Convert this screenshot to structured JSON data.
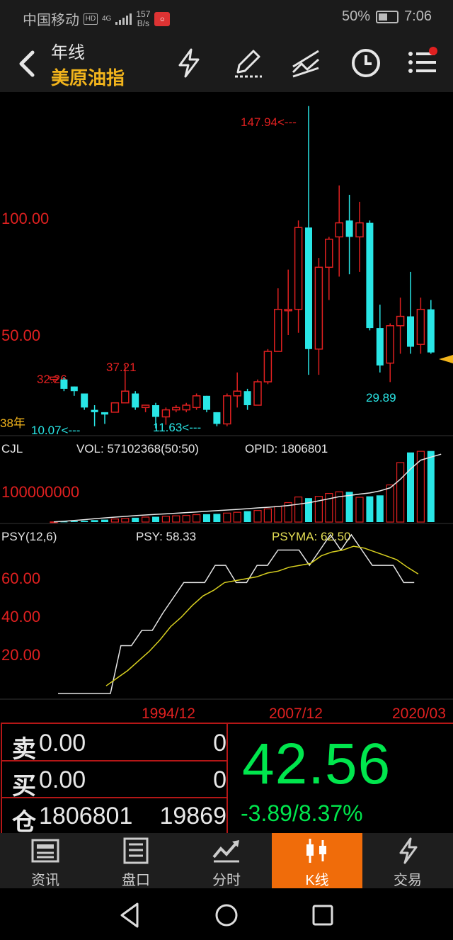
{
  "status_bar": {
    "carrier": "中国移动",
    "hd": "HD",
    "net": "4G",
    "speed_value": "157",
    "speed_unit": "B/s",
    "battery": "50%",
    "time": "7:06"
  },
  "header": {
    "period": "年线",
    "instrument": "美原油指"
  },
  "chart": {
    "y_labels": [
      "100.00",
      "50.00"
    ],
    "max_label": "147.94<---",
    "low_labels": {
      "first": "32.26",
      "mid": "37.21",
      "low1": "10.07<---",
      "low2": "11.63<---",
      "last_low": "29.89"
    },
    "left_tag": "38年",
    "vol_title": "CJL",
    "vol_text": "VOL: 57102368(50:50)",
    "opid_text": "OPID: 1806801",
    "vol_axis": "100000000",
    "psy_title": "PSY(12,6)",
    "psy_text": "PSY: 58.33",
    "psyma_text": "PSYMA: 62.50",
    "psy_axis": [
      "60.00",
      "40.00",
      "20.00"
    ],
    "x_labels": [
      "1994/12",
      "2007/12",
      "2020/03"
    ]
  },
  "chart_data": {
    "type": "candlestick",
    "y_axis_labels": [
      100.0,
      50.0
    ],
    "highest": 147.94,
    "lowest": 10.07,
    "last_low": 29.89,
    "candles": [
      {
        "o": 31,
        "c": 32,
        "h": 32.3,
        "l": 30,
        "up": true
      },
      {
        "o": 31,
        "c": 27,
        "h": 32,
        "l": 26,
        "up": false
      },
      {
        "o": 28,
        "c": 26,
        "h": 28,
        "l": 24,
        "up": false
      },
      {
        "o": 25,
        "c": 19,
        "h": 25,
        "l": 18,
        "up": false
      },
      {
        "o": 18,
        "c": 17,
        "h": 20,
        "l": 11,
        "up": false
      },
      {
        "o": 16,
        "c": 17,
        "h": 17,
        "l": 12,
        "up": false
      },
      {
        "o": 17,
        "c": 21,
        "h": 21,
        "l": 17,
        "up": true
      },
      {
        "o": 21,
        "c": 26,
        "h": 37.21,
        "l": 21,
        "up": true
      },
      {
        "o": 25,
        "c": 19,
        "h": 26,
        "l": 18,
        "up": false
      },
      {
        "o": 19,
        "c": 20,
        "h": 20,
        "l": 17,
        "up": true
      },
      {
        "o": 20,
        "c": 15,
        "h": 21,
        "l": 10.07,
        "up": false
      },
      {
        "o": 15,
        "c": 18,
        "h": 19,
        "l": 11.63,
        "up": true
      },
      {
        "o": 18,
        "c": 19,
        "h": 20,
        "l": 17,
        "up": true
      },
      {
        "o": 18,
        "c": 20,
        "h": 21,
        "l": 17,
        "up": true
      },
      {
        "o": 19,
        "c": 24,
        "h": 25,
        "l": 18,
        "up": true
      },
      {
        "o": 24,
        "c": 18,
        "h": 24,
        "l": 17,
        "up": false
      },
      {
        "o": 17,
        "c": 12,
        "h": 17,
        "l": 11,
        "up": false
      },
      {
        "o": 12,
        "c": 24,
        "h": 25,
        "l": 11,
        "up": true
      },
      {
        "o": 24,
        "c": 26,
        "h": 34,
        "l": 19,
        "up": true
      },
      {
        "o": 26,
        "c": 20,
        "h": 27,
        "l": 18,
        "up": false
      },
      {
        "o": 20,
        "c": 30,
        "h": 31,
        "l": 20,
        "up": true
      },
      {
        "o": 30,
        "c": 43,
        "h": 44,
        "l": 29,
        "up": true
      },
      {
        "o": 43,
        "c": 61,
        "h": 70,
        "l": 43,
        "up": true
      },
      {
        "o": 61,
        "c": 61,
        "h": 78,
        "l": 50,
        "up": true
      },
      {
        "o": 61,
        "c": 96,
        "h": 99,
        "l": 51,
        "up": true
      },
      {
        "o": 96,
        "c": 44,
        "h": 147.94,
        "l": 33,
        "up": false
      },
      {
        "o": 44,
        "c": 79,
        "h": 83,
        "l": 33,
        "up": true
      },
      {
        "o": 79,
        "c": 91,
        "h": 92,
        "l": 65,
        "up": true
      },
      {
        "o": 92,
        "c": 98,
        "h": 114,
        "l": 75,
        "up": true
      },
      {
        "o": 99,
        "c": 92,
        "h": 110,
        "l": 76,
        "up": false
      },
      {
        "o": 92,
        "c": 98,
        "h": 107,
        "l": 77,
        "up": true
      },
      {
        "o": 98,
        "c": 53,
        "h": 99,
        "l": 52,
        "up": false
      },
      {
        "o": 53,
        "c": 37,
        "h": 63,
        "l": 34,
        "up": false
      },
      {
        "o": 38,
        "c": 54,
        "h": 55,
        "l": 29.89,
        "up": true
      },
      {
        "o": 54,
        "c": 58,
        "h": 66,
        "l": 42,
        "up": true
      },
      {
        "o": 58,
        "c": 45,
        "h": 77,
        "l": 42,
        "up": false
      },
      {
        "o": 46,
        "c": 61,
        "h": 66,
        "l": 42,
        "up": true
      },
      {
        "o": 61,
        "c": 42.56,
        "h": 65,
        "l": 42,
        "up": false
      }
    ],
    "volume": [
      0.1,
      0.3,
      0.6,
      0.8,
      1.2,
      1.5,
      1.9,
      2.3,
      2.7,
      3.1,
      3.3,
      3.6,
      3.9,
      4.1,
      4.6,
      4.9,
      5.1,
      5.6,
      6.1,
      6.8,
      7.2,
      8.2,
      9.7,
      12.1,
      15.6,
      14.9,
      16.0,
      17.8,
      18.8,
      18.8,
      15.4,
      16.0,
      16.6,
      23.1,
      37.0,
      43.3,
      44.0,
      44.2,
      12.8
    ],
    "volume_ma": [
      0.1,
      0.5,
      1.0,
      1.5,
      2.1,
      2.6,
      3.1,
      3.5,
      4.0,
      4.4,
      4.8,
      5.1,
      5.5,
      5.9,
      6.3,
      6.7,
      7.1,
      7.5,
      7.9,
      8.3,
      8.8,
      9.2,
      9.7,
      10.3,
      11.1,
      12.0,
      13.2,
      14.5,
      15.8,
      16.5,
      17.4,
      18.1,
      19.4,
      21.3,
      26.6,
      33.0,
      38.5,
      40.4,
      42.2
    ],
    "psy": [
      0,
      0,
      0,
      0,
      0,
      0,
      25,
      25,
      33,
      33,
      42,
      50,
      58,
      58,
      58,
      67,
      67,
      58,
      58,
      67,
      67,
      75,
      75,
      75,
      67,
      75,
      83,
      75,
      83,
      75,
      67,
      67,
      67,
      58,
      58
    ],
    "psyma": [
      0,
      0,
      0,
      0,
      0,
      0,
      4,
      8,
      12,
      17,
      22,
      28,
      35,
      40,
      46,
      51,
      54,
      58,
      59,
      60,
      61,
      63,
      64,
      66,
      67,
      68,
      72,
      74,
      75,
      77,
      76,
      74,
      72,
      70,
      66,
      62.5
    ]
  },
  "quote": {
    "sell_label": "卖",
    "sell_value": "0.00",
    "sell_vol": "0",
    "buy_label": "买",
    "buy_value": "0.00",
    "buy_vol": "0",
    "pos_label": "仓",
    "pos_value": "1806801",
    "pos_change": "19869",
    "price": "42.56",
    "change": "-3.89/8.37%"
  },
  "nav": {
    "items": [
      {
        "label": "资讯",
        "icon": "news-icon"
      },
      {
        "label": "盘口",
        "icon": "orderbook-icon"
      },
      {
        "label": "分时",
        "icon": "timeshare-icon"
      },
      {
        "label": "K线",
        "icon": "kline-icon"
      },
      {
        "label": "交易",
        "icon": "trade-icon"
      }
    ],
    "active": "K线"
  },
  "colors": {
    "up": "#e02020",
    "down": "#29e6e6",
    "accent": "#f06c0a",
    "title_yellow": "#f2b41c",
    "price_green": "#00e64d"
  }
}
